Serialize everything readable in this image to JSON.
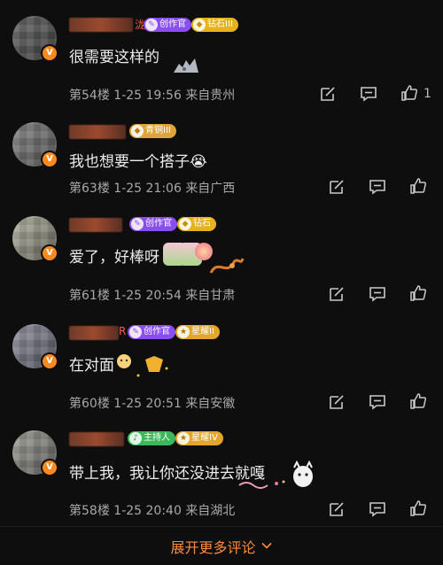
{
  "colors": {
    "background": "#0e0e0e",
    "text": "#ececec",
    "meta": "#a8a8a8",
    "accent": "#ff8a3d",
    "avatar_badge": "#ff8a1f"
  },
  "icons": {
    "reply": "edit-square-icon",
    "comment": "comment-bubble-icon",
    "like": "thumbs-up-icon",
    "verified": "v-badge-icon",
    "expand": "chevron-down-icon"
  },
  "comments": [
    {
      "nickname_tail": "泷",
      "badges": [
        {
          "icon": "✎",
          "label": "创作官",
          "style": "creator"
        },
        {
          "icon": "◆",
          "label": "钻石III",
          "style": "diamond"
        }
      ],
      "text": "很需要这样的",
      "floor": "第54楼",
      "date": "1-25 19:56",
      "location": "来自贵州",
      "likes": "1"
    },
    {
      "nickname_tail": "",
      "badges": [
        {
          "icon": "◆",
          "label": "青铜III",
          "style": "bronze"
        }
      ],
      "text": "我也想要一个搭子😭",
      "floor": "第63楼",
      "date": "1-25 21:06",
      "location": "来自广西",
      "likes": ""
    },
    {
      "nickname_tail": "",
      "badges": [
        {
          "icon": "✎",
          "label": "创作官",
          "style": "creator"
        },
        {
          "icon": "◆",
          "label": "钻石",
          "style": "diamond"
        }
      ],
      "text": "爱了，好棒呀",
      "floor": "第61楼",
      "date": "1-25 20:54",
      "location": "来自甘肃",
      "likes": ""
    },
    {
      "nickname_tail": "R",
      "badges": [
        {
          "icon": "✎",
          "label": "创作官",
          "style": "creator"
        },
        {
          "icon": "★",
          "label": "星耀II",
          "style": "star"
        }
      ],
      "text": "在对面",
      "floor": "第60楼",
      "date": "1-25 20:51",
      "location": "来自安徽",
      "likes": ""
    },
    {
      "nickname_tail": "",
      "badges": [
        {
          "icon": "♪",
          "label": "主持人",
          "style": "host"
        },
        {
          "icon": "★",
          "label": "星耀IV",
          "style": "star"
        }
      ],
      "text": "带上我，我让你还没进去就嘎",
      "floor": "第58楼",
      "date": "1-25 20:40",
      "location": "来自湖北",
      "likes": ""
    }
  ],
  "footer": {
    "expand_label": "展开更多评论"
  }
}
